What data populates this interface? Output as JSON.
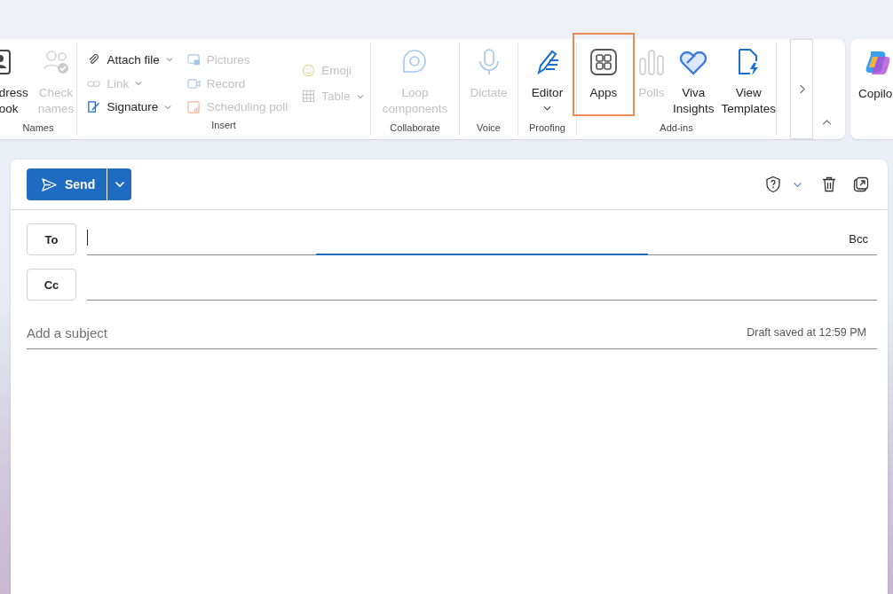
{
  "ribbon": {
    "groups": [
      {
        "label": "Names",
        "items": [
          {
            "lines": [
              "dress",
              "ook"
            ],
            "disabled": false,
            "highlighted": false,
            "caret": false
          },
          {
            "lines": [
              "Check",
              "names"
            ],
            "disabled": true,
            "highlighted": false,
            "caret": false
          }
        ]
      },
      {
        "label": "Insert",
        "columns": [
          [
            {
              "label": "Attach file",
              "disabled": false,
              "caret": true
            },
            {
              "label": "Link",
              "disabled": true,
              "caret": true
            },
            {
              "label": "Signature",
              "disabled": false,
              "caret": true
            }
          ],
          [
            {
              "label": "Pictures",
              "disabled": true,
              "caret": false
            },
            {
              "label": "Record",
              "disabled": true,
              "caret": false
            },
            {
              "label": "Scheduling poll",
              "disabled": true,
              "caret": false
            }
          ],
          [
            {
              "label": "Emoji",
              "disabled": true,
              "caret": false
            },
            {
              "label": "Table",
              "disabled": true,
              "caret": true
            }
          ]
        ]
      },
      {
        "label": "Collaborate",
        "items": [
          {
            "lines": [
              "Loop",
              "components"
            ],
            "disabled": true,
            "highlighted": false,
            "caret": false
          }
        ]
      },
      {
        "label": "Voice",
        "items": [
          {
            "lines": [
              "Dictate"
            ],
            "disabled": true,
            "highlighted": false,
            "caret": false
          }
        ]
      },
      {
        "label": "Proofing",
        "items": [
          {
            "lines": [
              "Editor"
            ],
            "disabled": false,
            "highlighted": false,
            "caret": true
          }
        ]
      },
      {
        "label": "Add-ins",
        "items": [
          {
            "lines": [
              "Apps"
            ],
            "disabled": false,
            "highlighted": true,
            "caret": false
          },
          {
            "lines": [
              "Polls"
            ],
            "disabled": true,
            "highlighted": false,
            "caret": false
          },
          {
            "lines": [
              "Viva",
              "Insights"
            ],
            "disabled": false,
            "highlighted": false,
            "caret": false
          },
          {
            "lines": [
              "View",
              "Templates"
            ],
            "disabled": false,
            "highlighted": false,
            "caret": false
          }
        ]
      }
    ],
    "copilot": "Copilo"
  },
  "compose": {
    "send": "Send",
    "to": "To",
    "cc": "Cc",
    "bcc": "Bcc",
    "subject": {
      "placeholder": "Add a subject"
    },
    "draft_status": "Draft saved at 12:59 PM"
  }
}
